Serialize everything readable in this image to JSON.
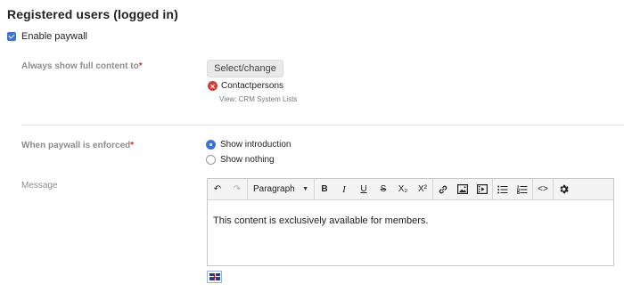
{
  "section": {
    "title": "Registered users (logged in)"
  },
  "paywall": {
    "checkbox_label": "Enable paywall",
    "checked": true
  },
  "always_show": {
    "label": "Always show full content to",
    "required_mark": "*",
    "button_label": "Select/change",
    "selected_item": "Contactpersons",
    "selected_item_sub": "View: CRM System Lists"
  },
  "enforced": {
    "label": "When paywall is enforced",
    "required_mark": "*",
    "options": [
      {
        "label": "Show introduction",
        "selected": true
      },
      {
        "label": "Show nothing",
        "selected": false
      }
    ]
  },
  "message": {
    "label": "Message",
    "toolbar": {
      "undo": "↶",
      "redo": "↷",
      "block_format": "Paragraph",
      "dropdown_caret": "▼",
      "bold": "B",
      "italic": "I",
      "underline": "U",
      "strikethrough": "S",
      "subscript": "X₂",
      "superscript": "X²",
      "code": "<>"
    },
    "content": "This content is exclusively available for members."
  },
  "language_flag": "uk-flag-icon",
  "colors": {
    "accent": "#3b74d4",
    "required": "#d0342c",
    "remove": "#d63b2f"
  }
}
